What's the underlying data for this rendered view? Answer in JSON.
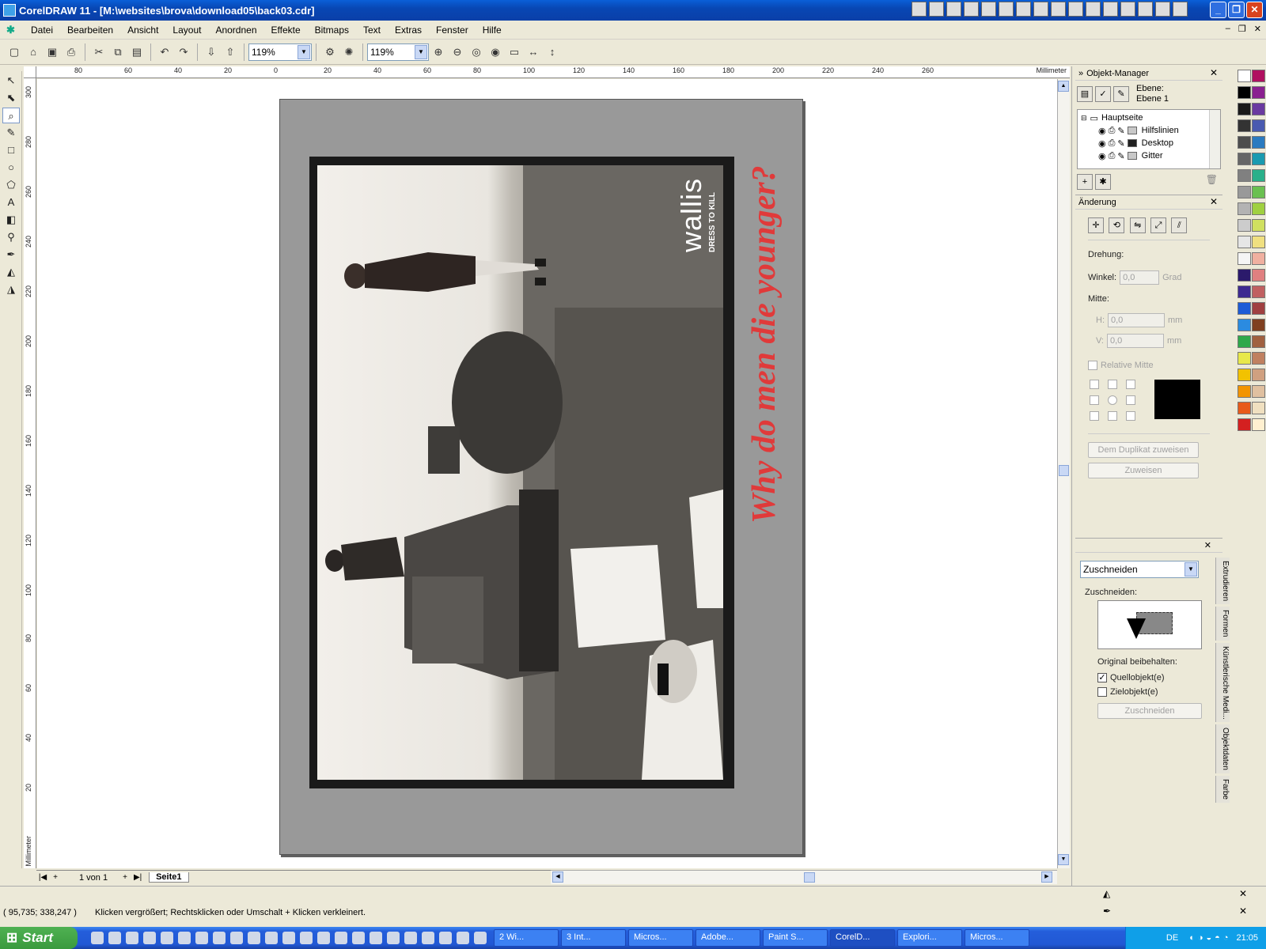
{
  "window": {
    "title": "CorelDRAW 11 - [M:\\websites\\brova\\download05\\back03.cdr]",
    "controls": [
      "_",
      "❐",
      "✕"
    ]
  },
  "menubar": {
    "items": [
      "Datei",
      "Bearbeiten",
      "Ansicht",
      "Layout",
      "Anordnen",
      "Effekte",
      "Bitmaps",
      "Text",
      "Extras",
      "Fenster",
      "Hilfe"
    ],
    "mdi_controls": [
      "–",
      "❐",
      "✕"
    ]
  },
  "toolbar": {
    "zoom1": "119%",
    "zoom2": "119%"
  },
  "rulers": {
    "unit": "Millimeter",
    "h_labels": [
      "80",
      "60",
      "40",
      "20",
      "0",
      "20",
      "40",
      "60",
      "80",
      "100",
      "120",
      "140",
      "160",
      "180",
      "200",
      "220",
      "240",
      "260"
    ],
    "v_labels": [
      "300",
      "280",
      "260",
      "240",
      "220",
      "200",
      "180",
      "160",
      "140",
      "120",
      "100",
      "80",
      "60",
      "40",
      "20"
    ]
  },
  "document": {
    "slogan": "Why do men die younger?",
    "logo_wordmark": "wallis",
    "logo_tagline": "DRESS TO KILL"
  },
  "pagebar": {
    "page_count": "1 von 1",
    "page_tab": "Seite1"
  },
  "object_manager": {
    "title": "Objekt-Manager",
    "layer_label": "Ebene:",
    "layer_value": "Ebene 1",
    "tree": {
      "root": "Hauptseite",
      "children": [
        {
          "name": "Hilfslinien",
          "color": "#c8c8c8"
        },
        {
          "name": "Desktop",
          "color": "#202020"
        },
        {
          "name": "Gitter",
          "color": "#c8c8c8"
        }
      ]
    }
  },
  "transform": {
    "title": "Änderung",
    "rotation_label": "Drehung:",
    "angle_label": "Winkel:",
    "angle_value": "0,0",
    "angle_unit": "Grad",
    "center_label": "Mitte:",
    "h_label": "H:",
    "h_value": "0,0",
    "v_label": "V:",
    "v_value": "0,0",
    "unit": "mm",
    "relative_center": "Relative Mitte",
    "duplicate_button": "Dem Duplikat zuweisen",
    "apply_button": "Zuweisen"
  },
  "shaping": {
    "mode": "Zuschneiden",
    "section_label": "Zuschneiden:",
    "keep_original": "Original beibehalten:",
    "source_label": "Quellobjekt(e)",
    "source_checked": true,
    "target_label": "Zielobjekt(e)",
    "target_checked": false,
    "button": "Zuschneiden"
  },
  "docker_tabs": [
    "Extrudieren",
    "Formen",
    "Künstlerische Medi...",
    "Objektdaten",
    "Farbe"
  ],
  "palette": [
    "#ffffff",
    "#000000",
    "#1a1a1a",
    "#333333",
    "#4d4d4d",
    "#666666",
    "#808080",
    "#999999",
    "#b3b3b3",
    "#cccccc",
    "#e6e6e6",
    "#f5f5f5",
    "#2b1a6b",
    "#3d2a90",
    "#1c5bd6",
    "#2b8be0",
    "#2ea84a",
    "#e8e84a",
    "#f2c200",
    "#f29400",
    "#e85a1a",
    "#d42020",
    "#b01060",
    "#8a2090",
    "#6a3aa0",
    "#4a5ab0",
    "#2a7ac0",
    "#1a9ab0",
    "#2ab08a",
    "#6ac050",
    "#a0d040",
    "#d0e060",
    "#f0e080",
    "#f0b0a0",
    "#e08080",
    "#c06060",
    "#a04040",
    "#804020",
    "#a06040",
    "#c08060",
    "#d0a080",
    "#e0c0a0",
    "#f0e0c0",
    "#fff0d0"
  ],
  "status": {
    "coords": "( 95,735; 338,247 )",
    "message": "Klicken vergrößert; Rechtsklicken oder Umschalt + Klicken verkleinert."
  },
  "taskbar": {
    "start": "Start",
    "tasks": [
      "2 Wi...",
      "3 Int...",
      "Micros...",
      "Adobe...",
      "Paint S...",
      "CorelD...",
      "Explori...",
      "Micros..."
    ],
    "active_task": "CorelD...",
    "lang": "DE",
    "clock": "21:05"
  }
}
